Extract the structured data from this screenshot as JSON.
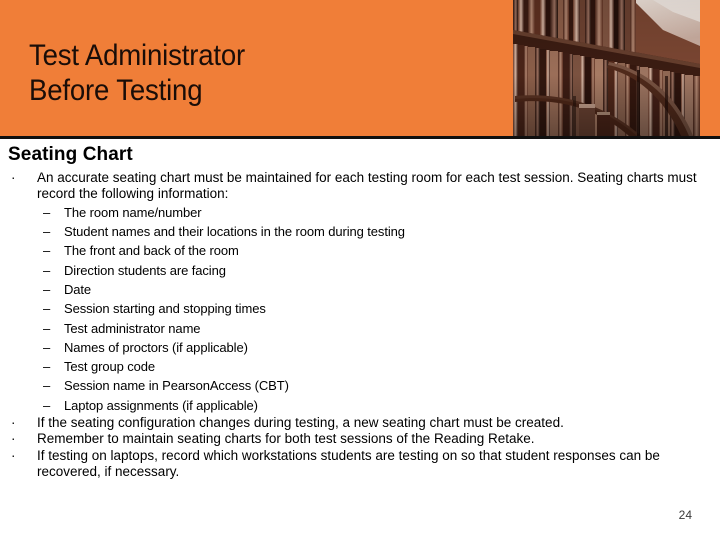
{
  "slide": {
    "header": {
      "title": "Test Administrator\nBefore Testing",
      "background_color": "#F07E38",
      "photo_alt": "library-bookshelves-photo"
    },
    "section_heading": "Seating Chart",
    "bullets": [
      {
        "level": 1,
        "marker": "·",
        "text": "An accurate seating chart must be maintained for each testing room for each test session. Seating charts must record the following information:"
      },
      {
        "level": 2,
        "marker": "–",
        "text": "The room name/number"
      },
      {
        "level": 2,
        "marker": "–",
        "text": "Student names and their locations in the room during testing"
      },
      {
        "level": 2,
        "marker": "–",
        "text": "The front and back of the room"
      },
      {
        "level": 2,
        "marker": "–",
        "text": "Direction students are facing"
      },
      {
        "level": 2,
        "marker": "–",
        "text": "Date"
      },
      {
        "level": 2,
        "marker": "–",
        "text": "Session starting and stopping times"
      },
      {
        "level": 2,
        "marker": "–",
        "text": "Test administrator name"
      },
      {
        "level": 2,
        "marker": "–",
        "text": "Names of proctors (if applicable)"
      },
      {
        "level": 2,
        "marker": "–",
        "text": "Test group code"
      },
      {
        "level": 2,
        "marker": "–",
        "text": "Session name in PearsonAccess (CBT)"
      },
      {
        "level": 2,
        "marker": "–",
        "text": "Laptop assignments (if applicable)"
      },
      {
        "level": 1,
        "marker": "·",
        "text": "If the seating configuration changes during testing, a new seating chart must be created."
      },
      {
        "level": 1,
        "marker": "·",
        "text": "Remember to maintain seating charts for both test sessions of the Reading Retake."
      },
      {
        "level": 1,
        "marker": "·",
        "text": "If testing on laptops, record which workstations students are testing on so that student responses can be recovered, if necessary."
      }
    ],
    "page_number": "24"
  }
}
